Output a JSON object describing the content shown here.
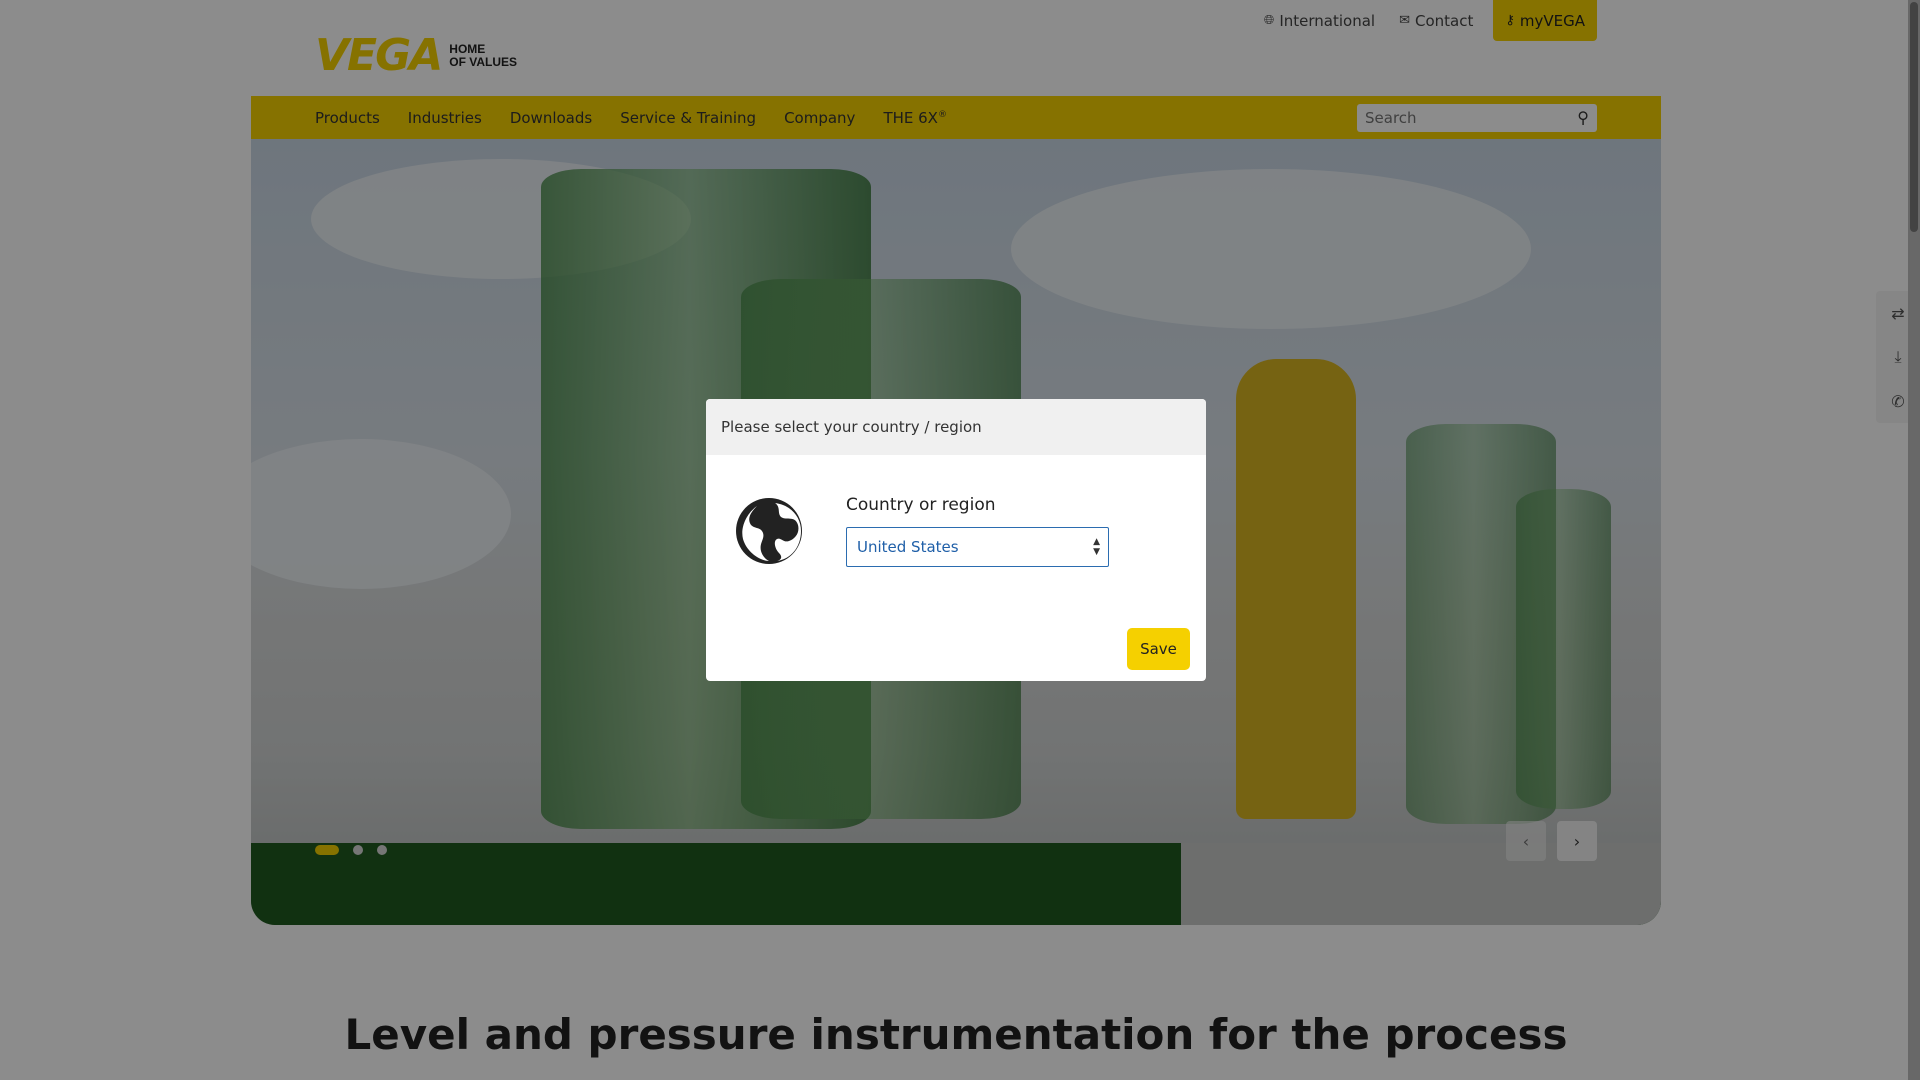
{
  "brand": {
    "logo": "VEGA",
    "tagline_1": "HOME",
    "tagline_2": "OF VALUES"
  },
  "utility_nav": {
    "international": "International",
    "contact": "Contact",
    "myvega": "myVEGA"
  },
  "main_nav": {
    "items": [
      "Products",
      "Industries",
      "Downloads",
      "Service & Training",
      "Company",
      "THE 6X"
    ],
    "trademark": "®"
  },
  "search": {
    "placeholder": "Search"
  },
  "hero": {
    "slides": 3,
    "active_slide": 1
  },
  "headline": "Level and pressure instrumentation for the process",
  "side_tools": [
    "compare-icon",
    "download-icon",
    "phone-icon"
  ],
  "modal": {
    "title": "Please select your country / region",
    "field_label": "Country or region",
    "selected_country": "United States",
    "save_label": "Save"
  },
  "colors": {
    "brand_yellow": "#f5d000",
    "select_border": "#2b6cb0"
  }
}
